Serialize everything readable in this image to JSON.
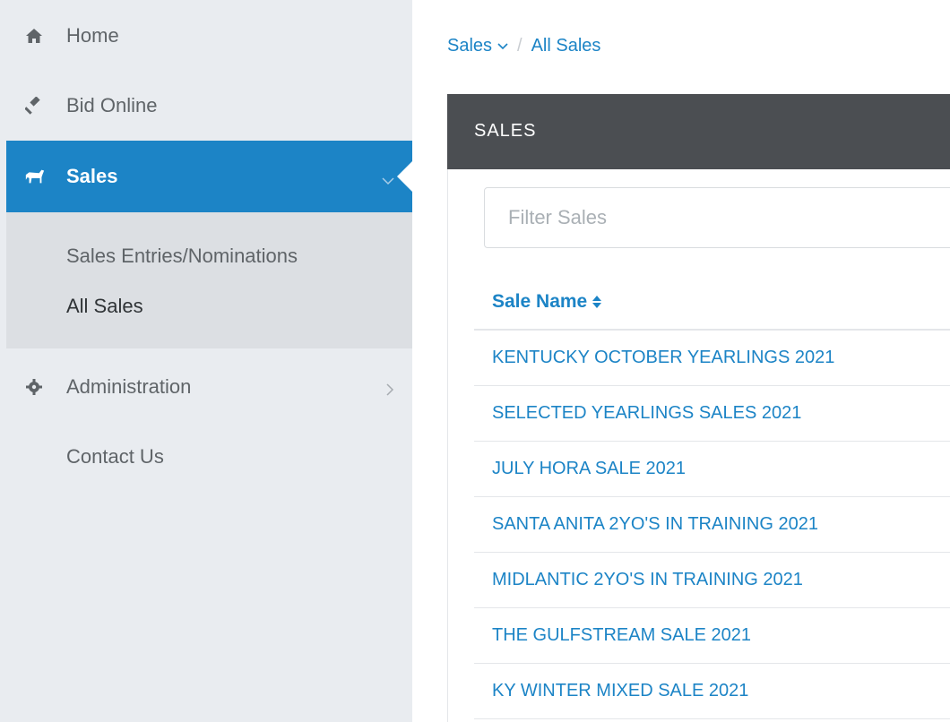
{
  "sidebar": {
    "items": [
      {
        "label": "Home",
        "icon": "home-icon"
      },
      {
        "label": "Bid Online",
        "icon": "gavel-icon"
      },
      {
        "label": "Sales",
        "icon": "horse-icon"
      },
      {
        "label": "Administration",
        "icon": "gear-icon"
      },
      {
        "label": "Contact Us",
        "icon": ""
      }
    ],
    "submenu": [
      {
        "label": "Sales Entries/Nominations"
      },
      {
        "label": "All Sales",
        "active": true
      }
    ]
  },
  "breadcrumb": {
    "root": "Sales",
    "separator": "/",
    "current": "All Sales"
  },
  "panel": {
    "title": "SALES"
  },
  "filter": {
    "placeholder": "Filter Sales",
    "value": ""
  },
  "table": {
    "header": "Sale Name",
    "rows": [
      "KENTUCKY OCTOBER YEARLINGS 2021",
      "SELECTED YEARLINGS SALES 2021",
      "JULY HORA SALE 2021",
      "SANTA ANITA 2YO'S IN TRAINING 2021",
      "MIDLANTIC 2YO'S IN TRAINING 2021",
      "THE GULFSTREAM SALE 2021",
      "KY WINTER MIXED SALE 2021"
    ]
  },
  "colors": {
    "accent": "#1c84c6",
    "sidebar_bg": "#e9ecf0",
    "header_bg": "#4b4e52"
  }
}
